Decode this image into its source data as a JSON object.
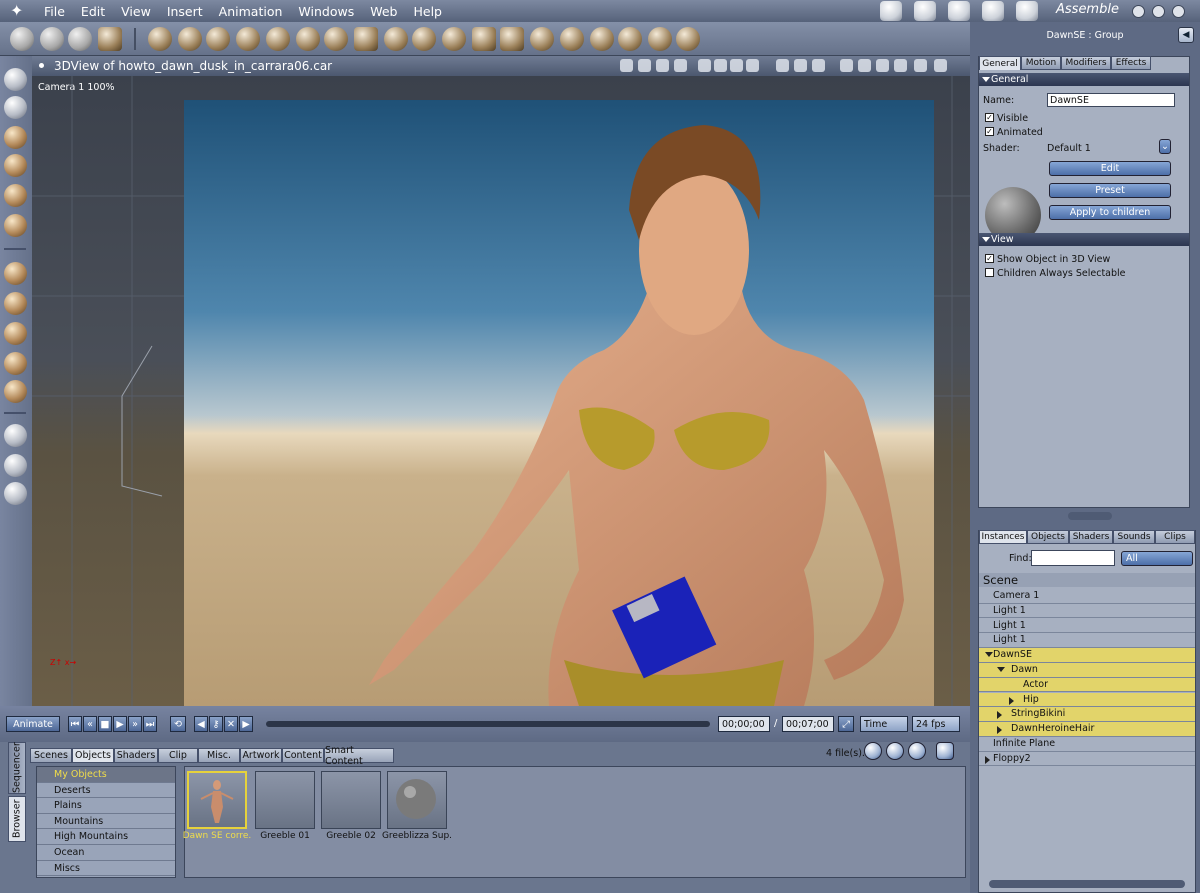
{
  "menu": [
    "File",
    "Edit",
    "View",
    "Insert",
    "Animation",
    "Windows",
    "Web",
    "Help"
  ],
  "room": "Assemble",
  "view": {
    "title": "3DView of howto_dawn_dusk_in_carrara06.car",
    "camera_label": "Camera 1 100%"
  },
  "timeline": {
    "animate_label": "Animate",
    "current_time": "00;00;00",
    "separator": "/",
    "end_time": "00;07;00",
    "time_mode": "Time",
    "fps": "24 fps"
  },
  "browser": {
    "side_tabs": [
      "Sequencer",
      "Browser"
    ],
    "tabs": [
      "Scenes",
      "Objects",
      "Shaders",
      "Clip",
      "Misc.",
      "Artwork",
      "Content",
      "Smart Content"
    ],
    "active_tab": "Objects",
    "categories": [
      "My Objects",
      "Deserts",
      "Plains",
      "Mountains",
      "High Mountains",
      "Ocean",
      "Miscs"
    ],
    "selected_category": "My Objects",
    "file_count": "4 file(s).",
    "thumbnails": [
      "Dawn SE corre.",
      "Greeble 01",
      "Greeble 02",
      "Greeblizza Sup."
    ]
  },
  "properties": {
    "title": "DawnSE : Group",
    "tabs": [
      "General",
      "Motion",
      "Modifiers",
      "Effects"
    ],
    "general_section": "General",
    "name_label": "Name:",
    "name_value": "DawnSE",
    "visible_label": "Visible",
    "visible_checked": true,
    "animated_label": "Animated",
    "animated_checked": true,
    "shader_label": "Shader:",
    "shader_value": "Default 1",
    "edit_label": "Edit",
    "preset_label": "Preset",
    "apply_label": "Apply to children",
    "view_section": "View",
    "show_object_label": "Show Object in 3D View",
    "show_object_checked": true,
    "children_selectable_label": "Children Always Selectable",
    "children_selectable_checked": false
  },
  "instances": {
    "tabs": [
      "Instances",
      "Objects",
      "Shaders",
      "Sounds",
      "Clips"
    ],
    "find_label": "Find:",
    "find_value": "",
    "filter_value": "All",
    "scene_label": "Scene",
    "rows": [
      {
        "label": "Camera 1",
        "indent": 0,
        "highlight": false,
        "toggle": "none"
      },
      {
        "label": "Light 1",
        "indent": 0,
        "highlight": false,
        "toggle": "none"
      },
      {
        "label": "Light 1",
        "indent": 0,
        "highlight": false,
        "toggle": "none"
      },
      {
        "label": "Light 1",
        "indent": 0,
        "highlight": false,
        "toggle": "none"
      },
      {
        "label": "DawnSE",
        "indent": 0,
        "highlight": true,
        "toggle": "open"
      },
      {
        "label": "Dawn",
        "indent": 1,
        "highlight": true,
        "toggle": "open"
      },
      {
        "label": "Actor",
        "indent": 2,
        "highlight": true,
        "toggle": "none"
      },
      {
        "label": "Hip",
        "indent": 2,
        "highlight": true,
        "toggle": "closed"
      },
      {
        "label": "StringBikini",
        "indent": 1,
        "highlight": true,
        "toggle": "closed"
      },
      {
        "label": "DawnHeroineHair",
        "indent": 1,
        "highlight": true,
        "toggle": "closed"
      },
      {
        "label": "Infinite Plane",
        "indent": 0,
        "highlight": false,
        "toggle": "none"
      },
      {
        "label": "Floppy2",
        "indent": 0,
        "highlight": false,
        "toggle": "closed"
      }
    ]
  }
}
